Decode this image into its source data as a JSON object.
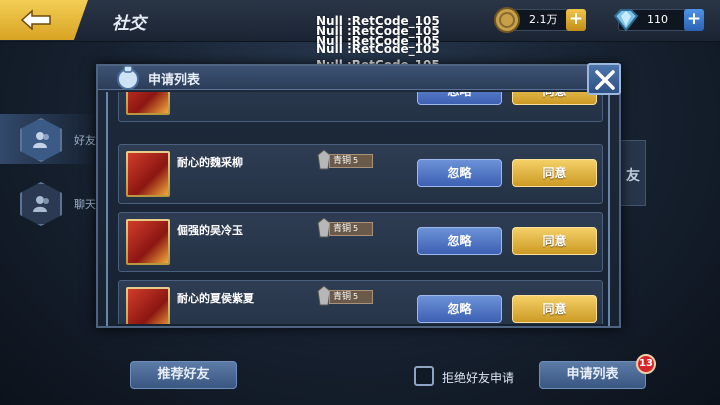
{
  "header": {
    "title": "社交",
    "gold_amount": "2.1万",
    "gem_amount": "110"
  },
  "debug_lines": [
    "Null :RetCode_105",
    "Null :RetCode_105",
    "Null :RetCode_105",
    "Null :RetCode_105",
    "Null :RetCode_105"
  ],
  "side_tabs": [
    {
      "label": "好友"
    },
    {
      "label": "聊天"
    }
  ],
  "right_tab_label": "友",
  "dialog": {
    "title": "申请列表",
    "ignore_label": "忽略",
    "agree_label": "同意",
    "rows": [
      {
        "name": "",
        "rank": "",
        "rank_level": ""
      },
      {
        "name": "耐心的魏采柳",
        "rank": "青铜",
        "rank_level": "5"
      },
      {
        "name": "倔强的吴冷玉",
        "rank": "青铜",
        "rank_level": "5"
      },
      {
        "name": "耐心的夏侯紫夏",
        "rank": "青铜",
        "rank_level": "5"
      }
    ]
  },
  "footer": {
    "recommend_label": "推荐好友",
    "reject_label": "拒绝好友申请",
    "apply_list_label": "申请列表",
    "apply_count": "13"
  },
  "colors": {
    "accent_gold": "#f2cf55",
    "ignore_blue": "#5477c6",
    "badge_red": "#d8232a"
  },
  "icons": [
    "back-arrow-icon",
    "coin-icon",
    "gem-icon",
    "plus-icon",
    "friends-icon",
    "chat-icon",
    "bag-icon",
    "close-icon",
    "rank-medal-icon"
  ]
}
